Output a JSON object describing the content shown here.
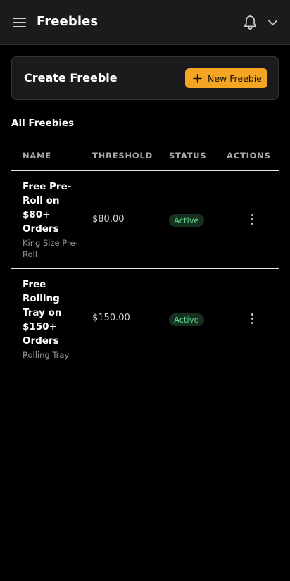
{
  "header": {
    "title": "Freebies",
    "menu_icon": "hamburger-menu-icon",
    "notification_icon": "bell-icon",
    "account_menu_icon": "chevron-down-icon"
  },
  "create_card": {
    "title": "Create Freebie",
    "button_label": "New Freebie",
    "button_icon": "plus-icon"
  },
  "list": {
    "title": "All Freebies",
    "columns": [
      "NAME",
      "THRESHOLD",
      "STATUS",
      "ACTIONS"
    ],
    "rows": [
      {
        "name": "Free Pre-Roll on $80+ Orders",
        "product": "King Size Pre-Roll",
        "threshold": "$80.00",
        "status": "Active",
        "actions_icon": "more-vertical-icon"
      },
      {
        "name": "Free Rolling Tray on $150+ Orders",
        "product": "Rolling Tray",
        "threshold": "$150.00",
        "status": "Active",
        "actions_icon": "more-vertical-icon"
      }
    ]
  },
  "colors": {
    "accent": "#f5a524",
    "background": "#000000",
    "surface": "#1b1b1d",
    "status_active_bg": "#15301f",
    "status_active_text": "#5fd38b"
  }
}
